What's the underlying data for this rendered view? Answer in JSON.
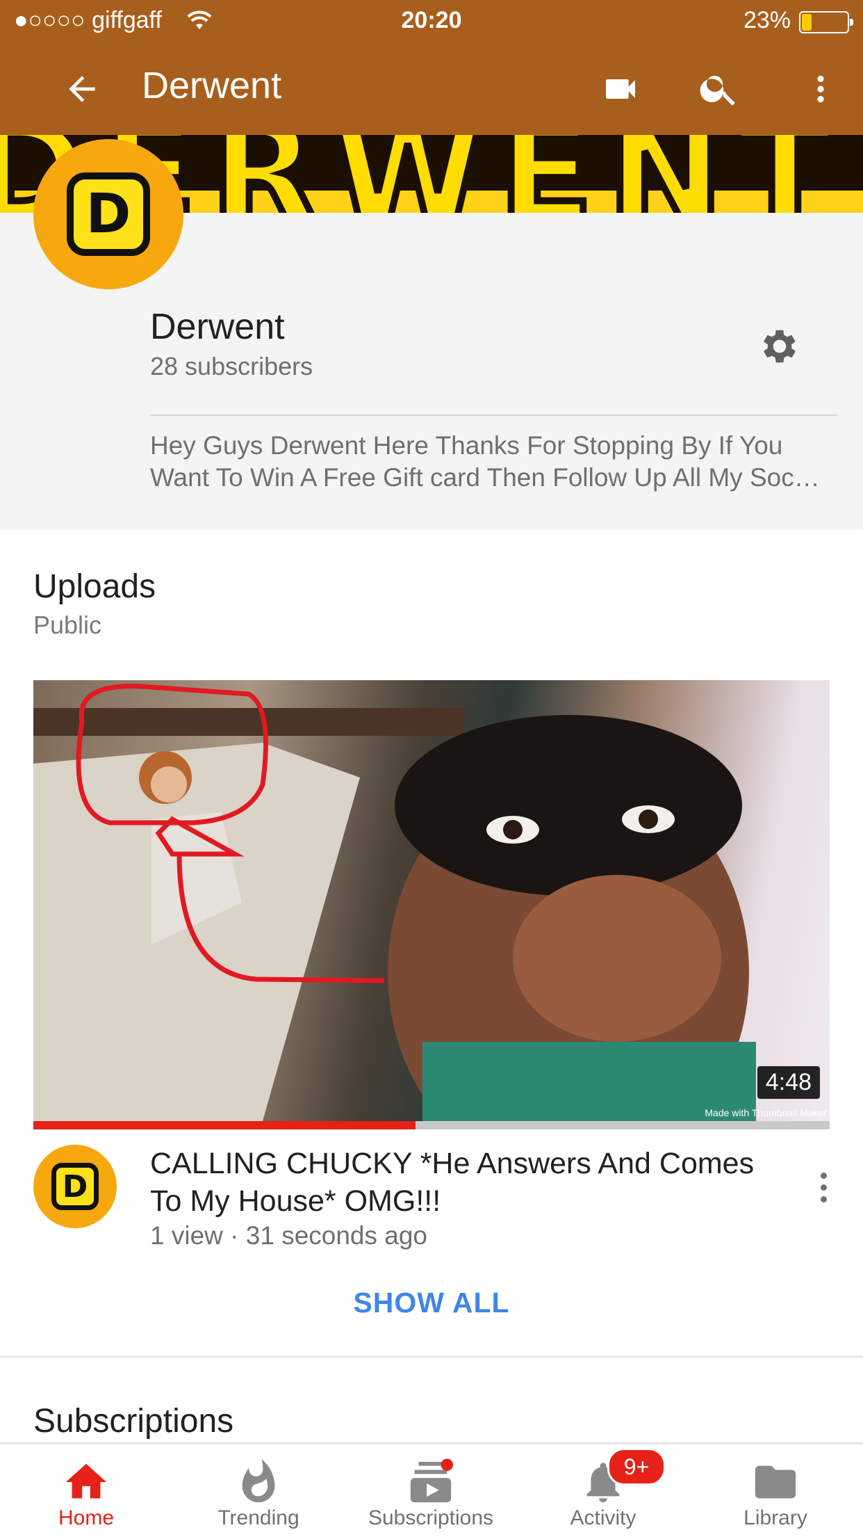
{
  "status_bar": {
    "carrier": "●○○○○ giffgaff",
    "time": "20:20",
    "battery": "23%"
  },
  "header": {
    "title": "Derwent",
    "icons": [
      "back-arrow-icon",
      "video-camera-icon",
      "search-icon",
      "more-vertical-icon"
    ]
  },
  "banner": {
    "text": "DERWENT"
  },
  "channel": {
    "logo_letter": "D",
    "name": "Derwent",
    "subscribers": "28 subscribers",
    "description_line1": "Hey Guys Derwent Here Thanks For Stopping By If You",
    "description_line2": "Want To Win A Free Gift card Then Follow Up All My Soc…"
  },
  "uploads": {
    "title": "Uploads",
    "subtitle": "Public",
    "video": {
      "duration": "4:48",
      "watermark": "Made with Thumbnail Maker",
      "watch_progress": 0.48,
      "title": "CALLING CHUCKY *He Answers And Comes To My House* OMG!!!",
      "meta": "1 view · 31 seconds ago"
    },
    "show_all": "SHOW ALL"
  },
  "subscriptions_section": {
    "title": "Subscriptions"
  },
  "bottom_nav": {
    "items": [
      {
        "label": "Home",
        "icon": "home-icon",
        "active": true
      },
      {
        "label": "Trending",
        "icon": "flame-icon",
        "active": false
      },
      {
        "label": "Subscriptions",
        "icon": "subscriptions-icon",
        "active": false
      },
      {
        "label": "Activity",
        "icon": "bell-icon",
        "active": false
      },
      {
        "label": "Library",
        "icon": "folder-icon",
        "active": false
      }
    ],
    "activity_badge": "9+"
  },
  "colors": {
    "app_bar": "#a85f1d",
    "accent_red": "#e62117",
    "link_blue": "#3e86e8",
    "logo_orange": "#f6a80e",
    "logo_yellow": "#ffe11a"
  }
}
